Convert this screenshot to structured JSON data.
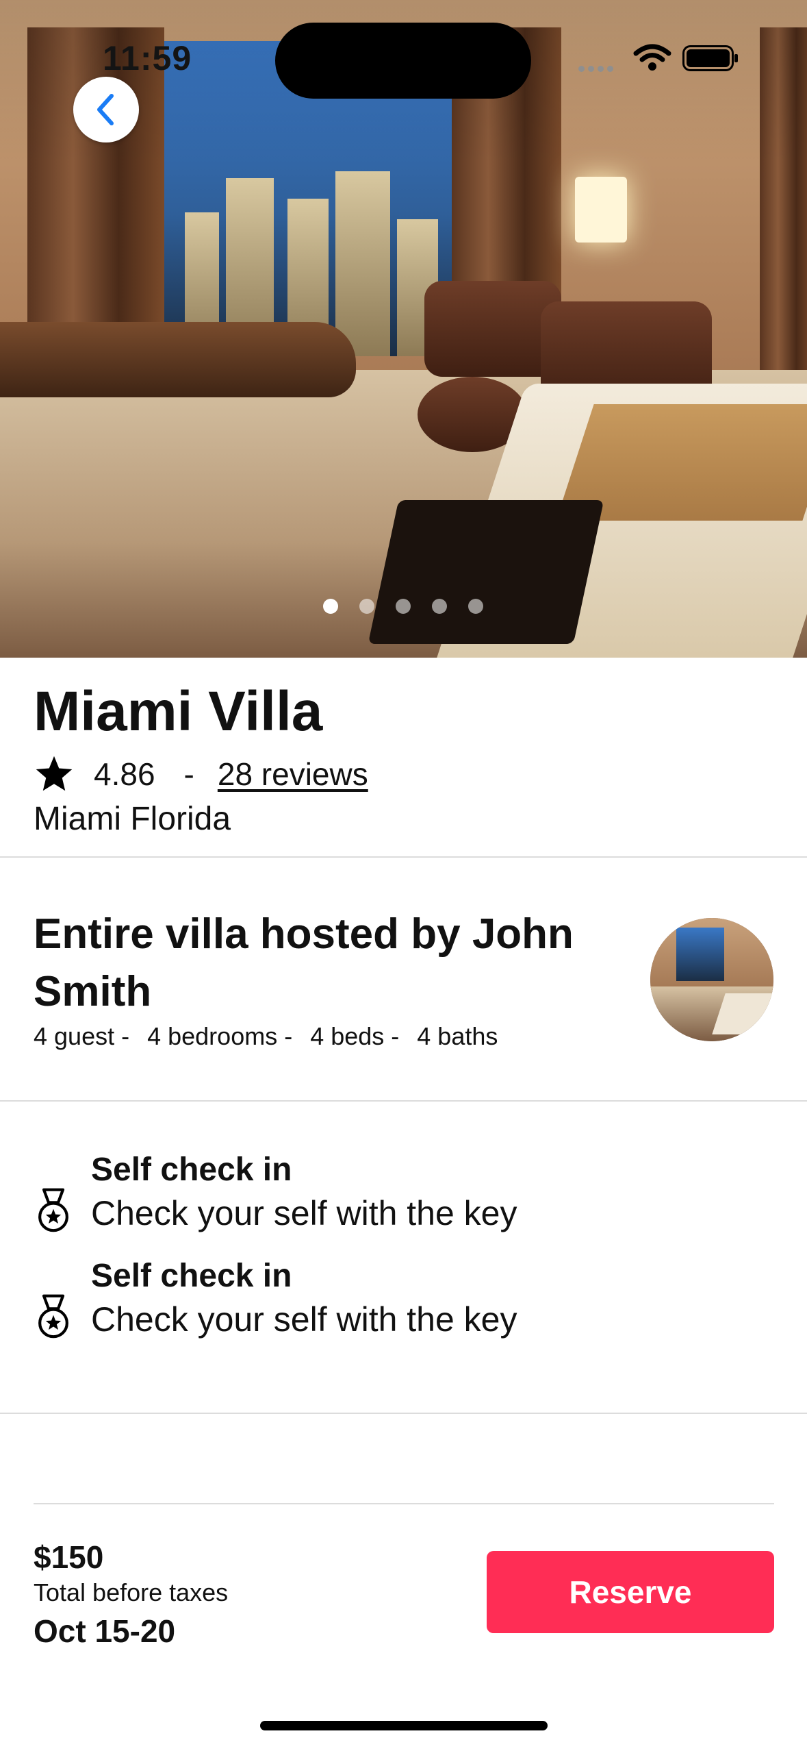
{
  "status_bar": {
    "time": "11:59"
  },
  "gallery": {
    "page_count": 5,
    "active_index": 0
  },
  "listing": {
    "title": "Miami Villa",
    "rating": "4.86",
    "separator": "-",
    "reviews_label": "28 reviews",
    "location": "Miami Florida"
  },
  "host": {
    "title": "Entire villa hosted by John Smith",
    "specs": [
      "4 guest -",
      "4 bedrooms -",
      "4 beds -",
      "4 baths"
    ]
  },
  "features": [
    {
      "icon": "medal-icon",
      "title": "Self check in",
      "subtitle": "Check your self with the key"
    },
    {
      "icon": "medal-icon",
      "title": "Self check in",
      "subtitle": "Check your self with the key"
    }
  ],
  "footer": {
    "price": "$150",
    "price_note": "Total before taxes",
    "dates": "Oct 15-20",
    "reserve_label": "Reserve"
  },
  "colors": {
    "accent": "#ff2d55",
    "back_chevron": "#1a7cf5"
  }
}
